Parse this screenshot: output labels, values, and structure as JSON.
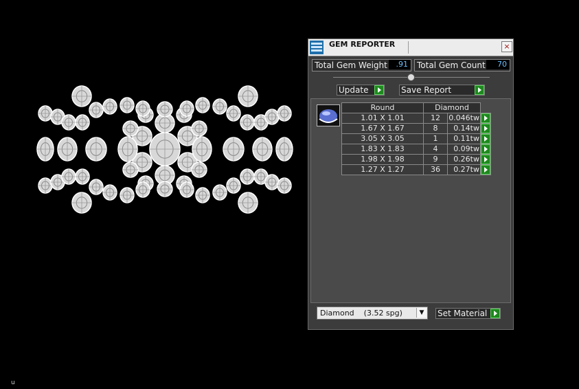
{
  "viewport": {
    "axis_label": "u"
  },
  "panel": {
    "title": "GEM REPORTER",
    "close_icon": "×",
    "total_gem_weight_label": "Total Gem Weight",
    "total_gem_weight_value": ".91",
    "total_gem_count_label": "Total Gem Count",
    "total_gem_count_value": "70",
    "update_label": "Update",
    "save_report_label": "Save Report",
    "table": {
      "headers": [
        "Round",
        "Diamond"
      ],
      "rows": [
        {
          "size": "1.01 X 1.01",
          "count": "12",
          "weight": "0.046tw"
        },
        {
          "size": "1.67 X 1.67",
          "count": "8",
          "weight": "0.14tw"
        },
        {
          "size": "3.05 X 3.05",
          "count": "1",
          "weight": "0.11tw"
        },
        {
          "size": "1.83 X 1.83",
          "count": "4",
          "weight": "0.09tw"
        },
        {
          "size": "1.98 X 1.98",
          "count": "9",
          "weight": "0.26tw"
        },
        {
          "size": "1.27 X 1.27",
          "count": "36",
          "weight": "0.27tw"
        }
      ]
    },
    "material_value": "Diamond    (3.52 spg)",
    "set_material_label": "Set Material"
  },
  "colors": {
    "panel_bg": "#3c3c3c",
    "accent_green": "#1d8a1d",
    "value_blue": "#6cc0ff"
  }
}
